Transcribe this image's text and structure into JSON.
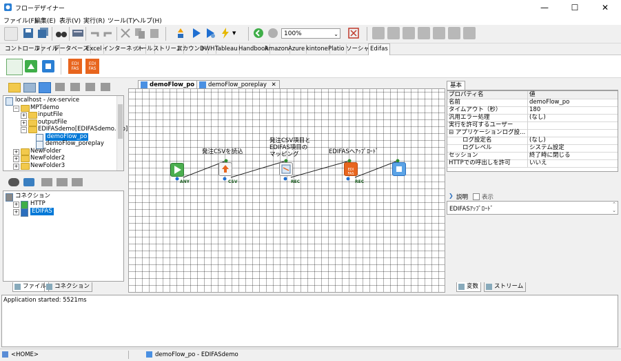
{
  "window": {
    "title": "フローデザイナー"
  },
  "menu": [
    "ファイル(F)",
    "編集(E)",
    "表示(V)",
    "実行(R)",
    "ツール(T)",
    "ヘルプ(H)"
  ],
  "toolbar": {
    "zoom": "100%"
  },
  "component_tabs": [
    "コントロール",
    "ファイル",
    "データベース",
    "Excel",
    "インターネット",
    "ツール",
    "ストリーム",
    "アカウント",
    "DWH",
    "Tableau",
    "Handbook",
    "Amazon",
    "Azure",
    "kintone",
    "Platio",
    "ソーシャル",
    "Edifas"
  ],
  "ribbon": {
    "edi1": "EDI\nFAS",
    "edi2": "EDI\nFAS"
  },
  "left_tree": [
    {
      "label": "localhost - /ex-service",
      "indent": 0
    },
    {
      "label": "MPTdemo",
      "indent": 1
    },
    {
      "label": "inputFile",
      "indent": 2
    },
    {
      "label": "outputFile",
      "indent": 2
    },
    {
      "label": "EDIFASdemo[EDIFASdemo.xfp]",
      "indent": 2
    },
    {
      "label": "demoFlow_po",
      "indent": 3,
      "selected": true
    },
    {
      "label": "demoFlow_poreplay",
      "indent": 3
    },
    {
      "label": "NewFolder",
      "indent": 1
    },
    {
      "label": "NewFolder2",
      "indent": 1
    },
    {
      "label": "NewFolder3",
      "indent": 1
    }
  ],
  "connection_tree": [
    {
      "label": "コネクション",
      "indent": 0
    },
    {
      "label": "HTTP",
      "indent": 1
    },
    {
      "label": "EDIFAS",
      "indent": 1,
      "selected": true
    }
  ],
  "left_bottom_tabs": [
    "ファイル",
    "コネクション"
  ],
  "doc_tabs": [
    {
      "label": "demoFlow_po",
      "close": "✕",
      "active": true
    },
    {
      "label": "demoFlow_poreplay",
      "close": "✕",
      "active": false
    }
  ],
  "flow": {
    "labels": {
      "n2": "発注CSVを読込",
      "n3": "発注CSV項目と\nEDIFAS項目の\nマッピング",
      "n4": "EDIFASへｱｯﾌﾟﾛｰﾄﾞ"
    },
    "tags": {
      "t1": "ANY",
      "t2": "CSV",
      "t3": "REC",
      "t4": "REC"
    },
    "node_text": {
      "edi": "EDI\nFAS"
    }
  },
  "right_panel": {
    "tab": "基本",
    "header": {
      "key": "プロパティ名",
      "value": "値"
    },
    "rows": [
      {
        "key": "名前",
        "value": "demoFlow_po"
      },
      {
        "key": "タイムアウト（秒）",
        "value": "180"
      },
      {
        "key": "汎用エラー処理",
        "value": "(なし)"
      },
      {
        "key": "実行を許可するユーザー",
        "value": ""
      },
      {
        "key": "⊟ アプリケーションログ設...",
        "value": ""
      },
      {
        "key": "ログ設定名",
        "value": "(なし)"
      },
      {
        "key": "ログレベル",
        "value": "システム設定"
      },
      {
        "key": "セッション",
        "value": "終了時に閉じる"
      },
      {
        "key": "HTTPでの呼出しを許可",
        "value": "いいえ"
      }
    ],
    "desc_label": "説明",
    "desc_check": "表示",
    "desc_text": "EDIFASｱｯﾌﾟﾛｰﾄﾞ",
    "bottom_tabs": [
      "変数",
      "ストリーム"
    ]
  },
  "log": {
    "text": "Application started: 5521ms"
  },
  "status": {
    "home": "<HOME>",
    "doc": "demoFlow_po - EDIFASdemo"
  },
  "colors": {
    "accent": "#0078d7",
    "selection": "#3399ff",
    "edifas_orange": "#e8651e",
    "start_green": "#4caf50",
    "end_blue": "#4a90e2"
  }
}
